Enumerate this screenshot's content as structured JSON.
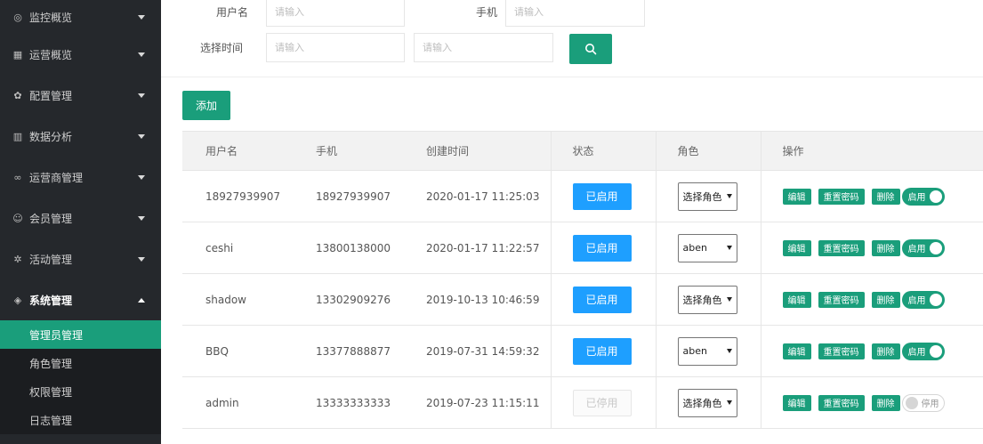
{
  "sidebar": {
    "menus": [
      {
        "icon": "monitor-icon",
        "glyph": "◎",
        "label": "监控概览"
      },
      {
        "icon": "operations-icon",
        "glyph": "▦",
        "label": "运营概览"
      },
      {
        "icon": "settings-icon",
        "glyph": "✿",
        "label": "配置管理"
      },
      {
        "icon": "data-icon",
        "glyph": "▥",
        "label": "数据分析"
      },
      {
        "icon": "carrier-icon",
        "glyph": "∞",
        "label": "运营商管理"
      },
      {
        "icon": "member-icon",
        "glyph": "☺",
        "label": "会员管理"
      },
      {
        "icon": "activity-icon",
        "glyph": "✲",
        "label": "活动管理"
      },
      {
        "icon": "system-icon",
        "glyph": "◈",
        "label": "系统管理"
      }
    ],
    "sub_items": [
      "管理员管理",
      "角色管理",
      "权限管理",
      "日志管理"
    ]
  },
  "filters": {
    "username_label": "用户名",
    "username_placeholder": "请输入",
    "phone_label": "手机",
    "phone_placeholder": "请输入",
    "time_label": "选择时间",
    "time_start_placeholder": "请输入",
    "time_end_placeholder": "请输入"
  },
  "actions": {
    "add_label": "添加"
  },
  "table": {
    "headers": [
      "用户名",
      "手机",
      "创建时间",
      "状态",
      "角色",
      "操作"
    ],
    "rows": [
      {
        "username": "18927939907",
        "phone": "18927939907",
        "created": "2020-01-17 11:25:03",
        "status": "已启用",
        "status_on": true,
        "role": "选择角色",
        "toggle": "启用",
        "toggle_on": true
      },
      {
        "username": "ceshi",
        "phone": "13800138000",
        "created": "2020-01-17 11:22:57",
        "status": "已启用",
        "status_on": true,
        "role": "aben",
        "toggle": "启用",
        "toggle_on": true
      },
      {
        "username": "shadow",
        "phone": "13302909276",
        "created": "2019-10-13 10:46:59",
        "status": "已启用",
        "status_on": true,
        "role": "选择角色",
        "toggle": "启用",
        "toggle_on": true
      },
      {
        "username": "BBQ",
        "phone": "13377888877",
        "created": "2019-07-31 14:59:32",
        "status": "已启用",
        "status_on": true,
        "role": "aben",
        "toggle": "启用",
        "toggle_on": true
      },
      {
        "username": "admin",
        "phone": "13333333333",
        "created": "2019-07-23 11:15:11",
        "status": "已停用",
        "status_on": false,
        "role": "选择角色",
        "toggle": "停用",
        "toggle_on": false
      }
    ],
    "op_labels": {
      "edit": "编辑",
      "reset": "重置密码",
      "delete": "删除"
    }
  },
  "colors": {
    "accent": "#1a9e7b",
    "status_blue": "#1e9fff",
    "sidebar_bg": "#25282c"
  }
}
